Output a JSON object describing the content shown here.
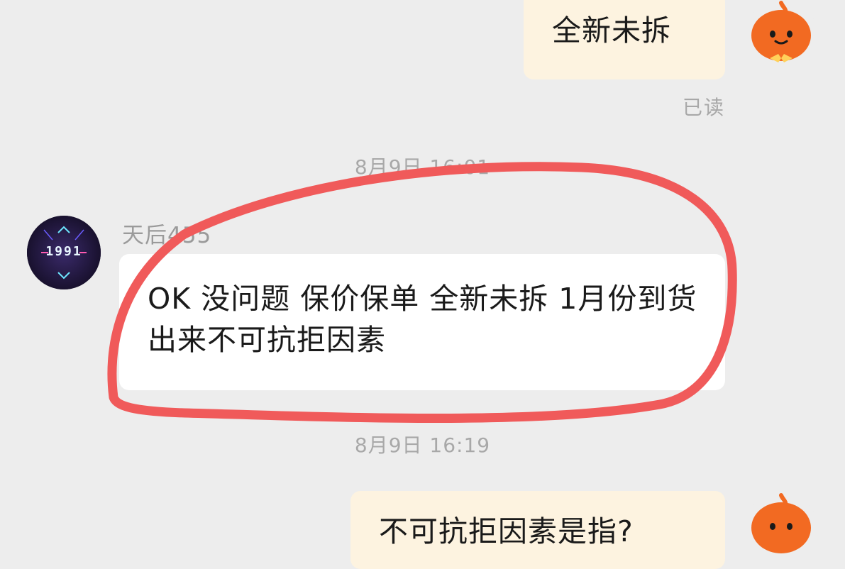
{
  "messages": [
    {
      "direction": "outgoing",
      "text": "全新未拆",
      "status": "已读"
    },
    {
      "timestamp": "8月9日 16:01"
    },
    {
      "direction": "incoming",
      "sender": "天后455",
      "avatar_text": "1991",
      "text": "OK 没问题 保价保单 全新未拆 1月份到货 出来不可抗拒因素"
    },
    {
      "timestamp": "8月9日 16:19"
    },
    {
      "direction": "outgoing",
      "text": "不可抗拒因素是指?"
    }
  ],
  "colors": {
    "background": "#ededed",
    "outgoing_bubble": "#fdf3e0",
    "incoming_bubble": "#ffffff",
    "annotation_circle": "#f05a5a",
    "self_avatar": "#f26a22"
  },
  "icons": {
    "self_avatar": "orange-mascot-icon",
    "contact_avatar": "neon-1991-logo-icon"
  }
}
